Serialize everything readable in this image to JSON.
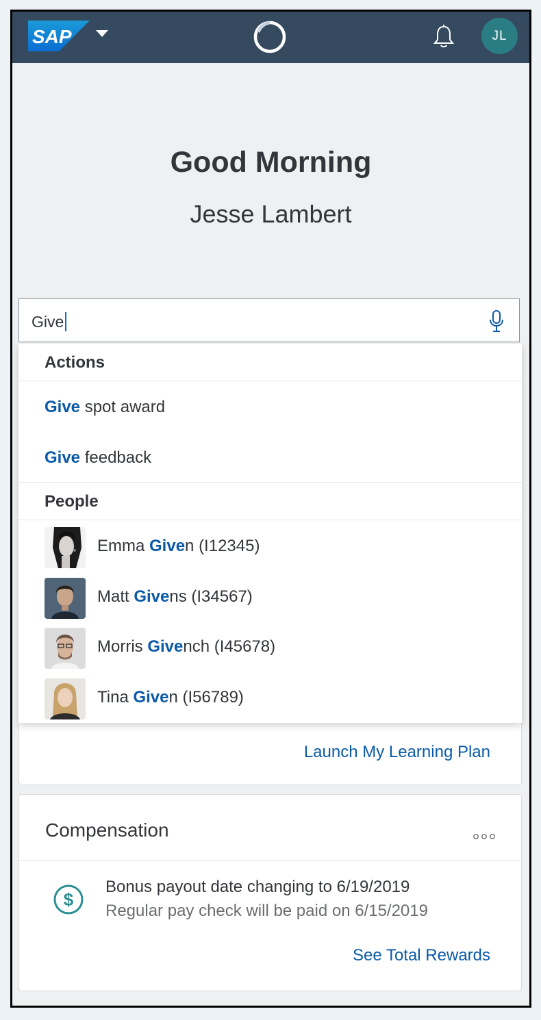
{
  "header": {
    "logo_text": "SAP",
    "avatar_initials": "JL"
  },
  "greeting": {
    "title": "Good Morning",
    "user_name": "Jesse Lambert"
  },
  "search": {
    "value": "Give"
  },
  "suggestions": {
    "actions_header": "Actions",
    "actions": [
      {
        "match": "Give",
        "rest": " spot award"
      },
      {
        "match": "Give",
        "rest": " feedback"
      }
    ],
    "people_header": "People",
    "people": [
      {
        "first": "Emma ",
        "match": "Give",
        "rest": "n (I12345)"
      },
      {
        "first": "Matt ",
        "match": "Give",
        "rest": "ns (I34567)"
      },
      {
        "first": "Morris ",
        "match": "Give",
        "rest": "nch (I45678)"
      },
      {
        "first": "Tina ",
        "match": "Give",
        "rest": "n (I56789)"
      }
    ]
  },
  "learning_card": {
    "link": "Launch My Learning Plan"
  },
  "compensation_card": {
    "title": "Compensation",
    "line1": "Bonus payout date changing to 6/19/2019",
    "line2": "Regular pay check will be paid on 6/15/2019",
    "link": "See Total Rewards"
  },
  "colors": {
    "shell": "#354a5f",
    "avatar": "#2b7d84",
    "link": "#0a5aa8",
    "icon_teal": "#2b8f94"
  },
  "icons": [
    "sap-logo",
    "chevron-down-icon",
    "copilot-icon",
    "bell-icon",
    "microphone-icon",
    "more-icon",
    "dollar-icon"
  ]
}
